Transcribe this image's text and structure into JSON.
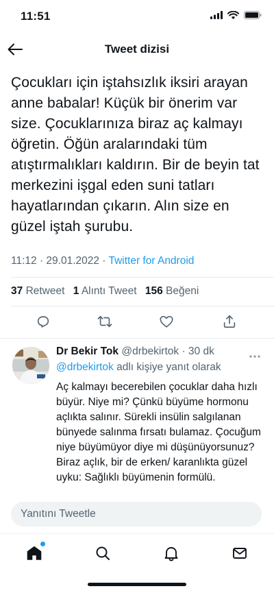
{
  "status_bar": {
    "time": "11:51"
  },
  "nav": {
    "title": "Tweet dizisi"
  },
  "tweet": {
    "text": "Çocukları için iştahsızlık iksiri arayan anne babalar! Küçük bir önerim var size. Çocuklarınıza biraz aç kalmayı öğretin. Öğün aralarındaki tüm atıştırmalıkları kaldırın. Bir de beyin tat merkezini işgal eden suni tatları hayatlarından çıkarın. Alın size en güzel iştah şurubu.",
    "time": "11:12 · 29.01.2022 · ",
    "client": "Twitter for Android",
    "stats": {
      "retweets": "37",
      "retweets_label": "Retweet",
      "quotes": "1",
      "quotes_label": "Alıntı Tweet",
      "likes": "156",
      "likes_label": "Beğeni"
    }
  },
  "reply": {
    "name": "Dr Bekir Tok",
    "handle": "@drbekirtok · 30 dk",
    "mention": "@drbekirtok",
    "reply_to_suffix": "adlı kişiye yanıt olarak",
    "text": "Aç kalmayı becerebilen çocuklar daha hızlı büyür. Niye mi? Çünkü büyüme hormonu açlıkta salınır. Sürekli insülin salgılanan bünyede salınma fırsatı bulamaz. Çocuğum niye büyümüyor diye mi düşünüyorsunuz? Biraz açlık, bir de erken/ karanlıkta güzel uyku: Sağlıklı büyümenin formülü."
  },
  "compose": {
    "placeholder": "Yanıtını Tweetle"
  },
  "colors": {
    "accent": "#1d9bf0",
    "text": "#0f1419",
    "muted": "#536471"
  },
  "icons": {
    "back": "arrow-left-icon",
    "reply": "reply-icon",
    "retweet": "retweet-icon",
    "like": "heart-icon",
    "share": "share-icon",
    "home": "home-icon",
    "search": "search-icon",
    "notifications": "bell-icon",
    "messages": "mail-icon"
  }
}
